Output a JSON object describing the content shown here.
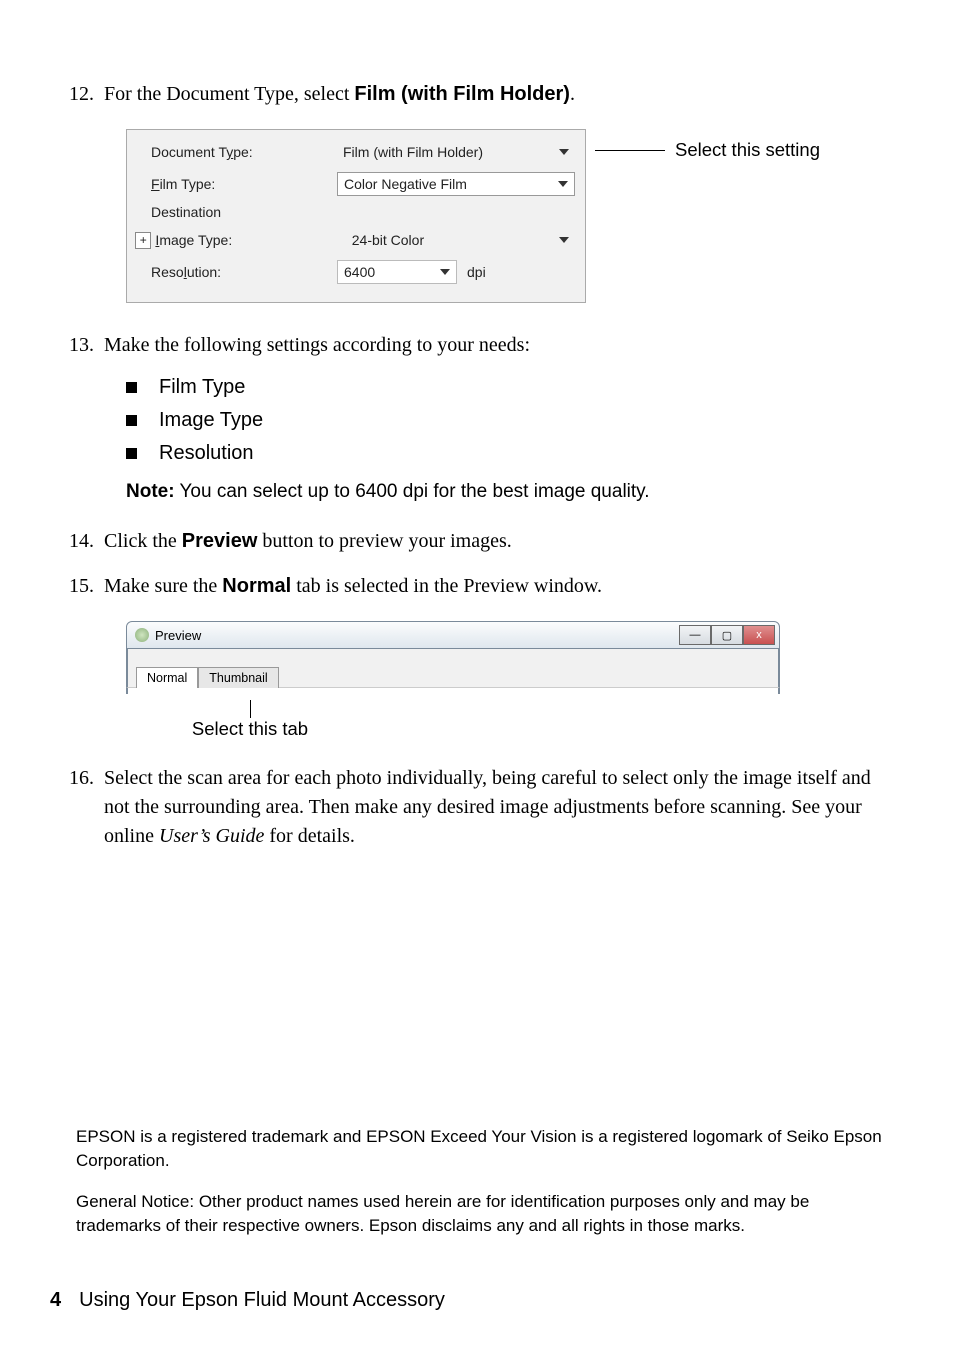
{
  "steps": {
    "s12": {
      "num": "12.",
      "prefix": "For the Document Type, select ",
      "setting": "Film (with Film Holder)",
      "suffix": "."
    },
    "s13": {
      "num": "13.",
      "text": "Make the following settings according to your needs:"
    },
    "s14": {
      "num": "14.",
      "prefix": "Click the ",
      "button": "Preview",
      "suffix": " button to preview your images."
    },
    "s15": {
      "num": "15.",
      "prefix": "Make sure the ",
      "tab": "Normal",
      "suffix": " tab is selected in the Preview window."
    },
    "s16": {
      "num": "16.",
      "text_a": "Select the scan area for each photo individually, being careful to select only the image itself and not the surrounding area. Then make any desired image adjustments before scanning. See your online ",
      "guide": "User’s Guide",
      "text_b": " for details."
    }
  },
  "settings_panel": {
    "labels": {
      "doc_type": "Document Type:",
      "film_type": "Film Type:",
      "destination": "Destination",
      "image_type": "Image Type:",
      "resolution": "Resolution:"
    },
    "values": {
      "doc_type": "Film (with Film Holder)",
      "film_type": "Color Negative Film",
      "image_type": "24-bit Color",
      "resolution": "6400",
      "res_unit": "dpi"
    },
    "expand": "+",
    "callout": "Select this setting"
  },
  "bullets": {
    "b1": "Film Type",
    "b2": "Image Type",
    "b3": "Resolution"
  },
  "note": {
    "label": "Note:",
    "text": " You can select up to 6400 dpi for the best image quality."
  },
  "preview_window": {
    "title": "Preview",
    "tabs": {
      "normal": "Normal",
      "thumbnail": "Thumbnail"
    },
    "buttons": {
      "min": "—",
      "max": "▢",
      "close": "x"
    },
    "callout": "Select this tab"
  },
  "legal": {
    "p1": "EPSON is a registered trademark and EPSON Exceed Your Vision is a registered logomark of Seiko Epson Corporation.",
    "p2": "General Notice: Other product names used herein are for identification purposes only and may be trademarks of their respective owners. Epson disclaims any and all rights in those marks."
  },
  "footer": {
    "page": "4",
    "title": "Using Your Epson Fluid Mount Accessory"
  }
}
